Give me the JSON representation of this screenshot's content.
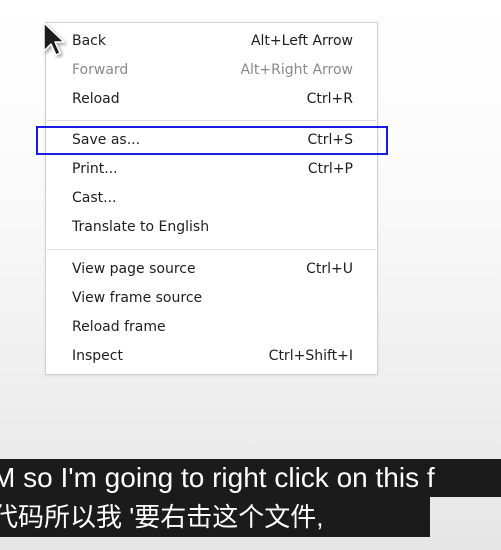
{
  "context_menu": {
    "items": [
      {
        "label": "Back",
        "accel": "Alt+Left Arrow",
        "disabled": false
      },
      {
        "label": "Forward",
        "accel": "Alt+Right Arrow",
        "disabled": true
      },
      {
        "label": "Reload",
        "accel": "Ctrl+R",
        "disabled": false
      },
      {
        "label": "Save as...",
        "accel": "Ctrl+S",
        "disabled": false
      },
      {
        "label": "Print...",
        "accel": "Ctrl+P",
        "disabled": false
      },
      {
        "label": "Cast...",
        "accel": "",
        "disabled": false
      },
      {
        "label": "Translate to English",
        "accel": "",
        "disabled": false
      },
      {
        "label": "View page source",
        "accel": "Ctrl+U",
        "disabled": false
      },
      {
        "label": "View frame source",
        "accel": "",
        "disabled": false
      },
      {
        "label": "Reload frame",
        "accel": "",
        "disabled": false
      },
      {
        "label": "Inspect",
        "accel": "Ctrl+Shift+I",
        "disabled": false
      }
    ]
  },
  "highlight": {
    "target": "Save as...",
    "color": "#1a1ae6"
  },
  "subtitles": {
    "line1": "M so I'm going to right click on this f",
    "line2": "代码所以我 '要右击这个文件,"
  }
}
